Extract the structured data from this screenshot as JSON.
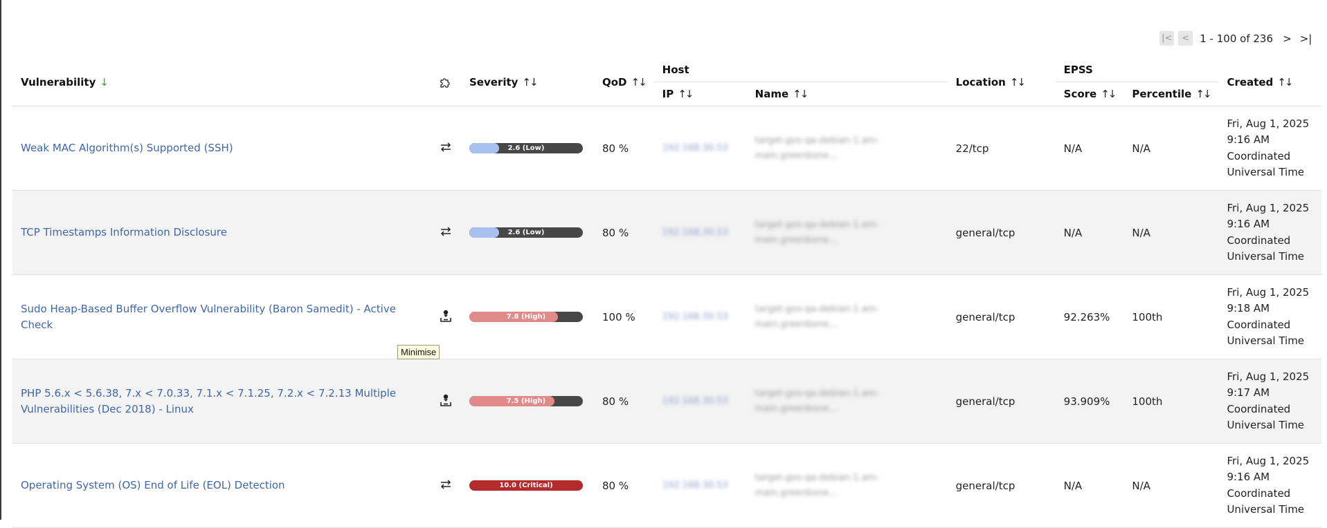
{
  "pagination": {
    "range_text": "1 - 100 of 236",
    "first_icon": "first-page-icon",
    "prev_icon": "prev-page-icon",
    "next_icon": "next-page-icon",
    "last_icon": "last-page-icon"
  },
  "columns": {
    "vulnerability": "Vulnerability",
    "solution_icon": "puzzle-icon",
    "severity": "Severity",
    "qod": "QoD",
    "host": "Host",
    "ip": "IP",
    "name": "Name",
    "location": "Location",
    "epss": "EPSS",
    "score": "Score",
    "percentile": "Percentile",
    "created": "Created"
  },
  "sort_indicators": {
    "active": "↓",
    "inactive": "↑↓"
  },
  "rows": [
    {
      "name": "Weak MAC Algorithm(s) Supported (SSH)",
      "solution_icon": "mitigation-icon",
      "severity_label": "2.6 (Low)",
      "severity_value": 2.6,
      "qod": "80 %",
      "ip": "192.168.30.53",
      "host_name": "target-gos-qa-debian-1.am-main.greenbone...",
      "location": "22/tcp",
      "epss_score": "N/A",
      "epss_percentile": "N/A",
      "created": [
        "Fri, Aug 1, 2025",
        "9:16 AM",
        "Coordinated",
        "Universal Time"
      ]
    },
    {
      "name": "TCP Timestamps Information Disclosure",
      "solution_icon": "mitigation-icon",
      "severity_label": "2.6 (Low)",
      "severity_value": 2.6,
      "qod": "80 %",
      "ip": "192.168.30.53",
      "host_name": "target-gos-qa-debian-1.am-main.greenbone...",
      "location": "general/tcp",
      "epss_score": "N/A",
      "epss_percentile": "N/A",
      "created": [
        "Fri, Aug 1, 2025",
        "9:16 AM",
        "Coordinated",
        "Universal Time"
      ]
    },
    {
      "name": "Sudo Heap-Based Buffer Overflow Vulnerability (Baron Samedit) - Active Check",
      "solution_icon": "vendor-fix-icon",
      "severity_label": "7.8 (High)",
      "severity_value": 7.8,
      "qod": "100 %",
      "ip": "192.168.30.53",
      "host_name": "target-gos-qa-debian-1.am-main.greenbone...",
      "location": "general/tcp",
      "epss_score": "92.263%",
      "epss_percentile": "100th",
      "created": [
        "Fri, Aug 1, 2025",
        "9:18 AM",
        "Coordinated",
        "Universal Time"
      ]
    },
    {
      "name": "PHP 5.6.x < 5.6.38, 7.x < 7.0.33, 7.1.x < 7.1.25, 7.2.x < 7.2.13 Multiple Vulnerabilities (Dec 2018) - Linux",
      "solution_icon": "vendor-fix-icon",
      "severity_label": "7.5 (High)",
      "severity_value": 7.5,
      "qod": "80 %",
      "ip": "192.168.30.53",
      "host_name": "target-gos-qa-debian-1.am-main.greenbone...",
      "location": "general/tcp",
      "epss_score": "93.909%",
      "epss_percentile": "100th",
      "created": [
        "Fri, Aug 1, 2025",
        "9:17 AM",
        "Coordinated",
        "Universal Time"
      ]
    },
    {
      "name": "Operating System (OS) End of Life (EOL) Detection",
      "solution_icon": "mitigation-icon",
      "severity_label": "10.0 (Critical)",
      "severity_value": 10.0,
      "qod": "80 %",
      "ip": "192.168.30.53",
      "host_name": "target-gos-qa-debian-1.am-main.greenbone...",
      "location": "general/tcp",
      "epss_score": "N/A",
      "epss_percentile": "N/A",
      "created": [
        "Fri, Aug 1, 2025",
        "9:16 AM",
        "Coordinated",
        "Universal Time"
      ]
    }
  ],
  "tooltip": {
    "text": "Minimise"
  },
  "colors": {
    "link": "#3f66a8",
    "severity_low": "#a9c1ee",
    "severity_high": "#e08a8a",
    "severity_critical": "#b52b2b",
    "severity_track": "#474747",
    "row_alt": "#f3f3f3",
    "sort_active": "#4a9a3a"
  }
}
